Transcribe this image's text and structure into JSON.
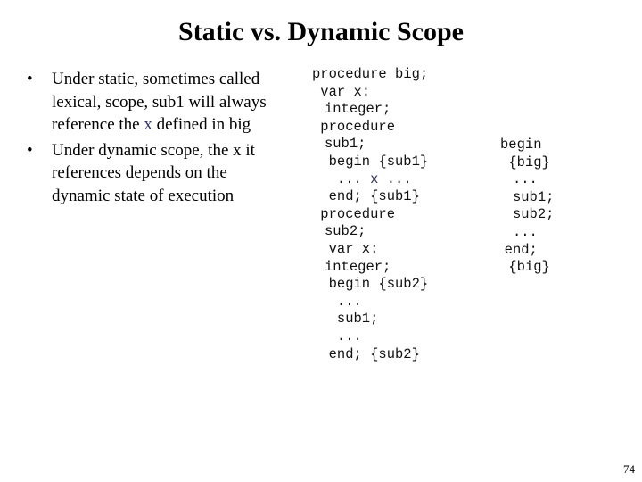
{
  "slide": {
    "title": "Static vs. Dynamic Scope",
    "page_number": "74",
    "accent_color": "#333366"
  },
  "bullets": [
    {
      "text_before": "Under static, sometimes called lexical, scope, sub1 will always reference the ",
      "highlight": "x",
      "text_after": " defined in big"
    },
    {
      "text_before": "Under dynamic scope, the x it references depends on the dynamic state of execution",
      "highlight": "",
      "text_after": ""
    }
  ],
  "code_left": [
    {
      "text": "procedure big;",
      "indent": 0
    },
    {
      "text": "var x:",
      "indent": 2
    },
    {
      "text": "integer;",
      "indent": 3
    },
    {
      "text": "procedure",
      "indent": 2
    },
    {
      "text": "sub1;",
      "indent": 3
    },
    {
      "text": "begin {sub1}",
      "indent": 4
    },
    {
      "text": "... ",
      "highlight": "x",
      "after": " ...",
      "indent": 6
    },
    {
      "text": "end; {sub1}",
      "indent": 4
    },
    {
      "text": "procedure",
      "indent": 2
    },
    {
      "text": "sub2;",
      "indent": 3
    },
    {
      "text": "var x:",
      "indent": 4
    },
    {
      "text": "integer;",
      "indent": 3
    },
    {
      "text": "begin {sub2}",
      "indent": 4
    },
    {
      "text": "...",
      "indent": 6
    },
    {
      "text": "sub1;",
      "indent": 6
    },
    {
      "text": "...",
      "indent": 6
    },
    {
      "text": "end; {sub2}",
      "indent": 4
    }
  ],
  "code_right": [
    {
      "text": "begin",
      "indent": 0
    },
    {
      "text": "{big}",
      "indent": 2
    },
    {
      "text": "...",
      "indent": 3
    },
    {
      "text": "sub1;",
      "indent": 3
    },
    {
      "text": "sub2;",
      "indent": 3
    },
    {
      "text": "...",
      "indent": 3
    },
    {
      "text": "end;",
      "indent": 1
    },
    {
      "text": "{big}",
      "indent": 2
    }
  ]
}
